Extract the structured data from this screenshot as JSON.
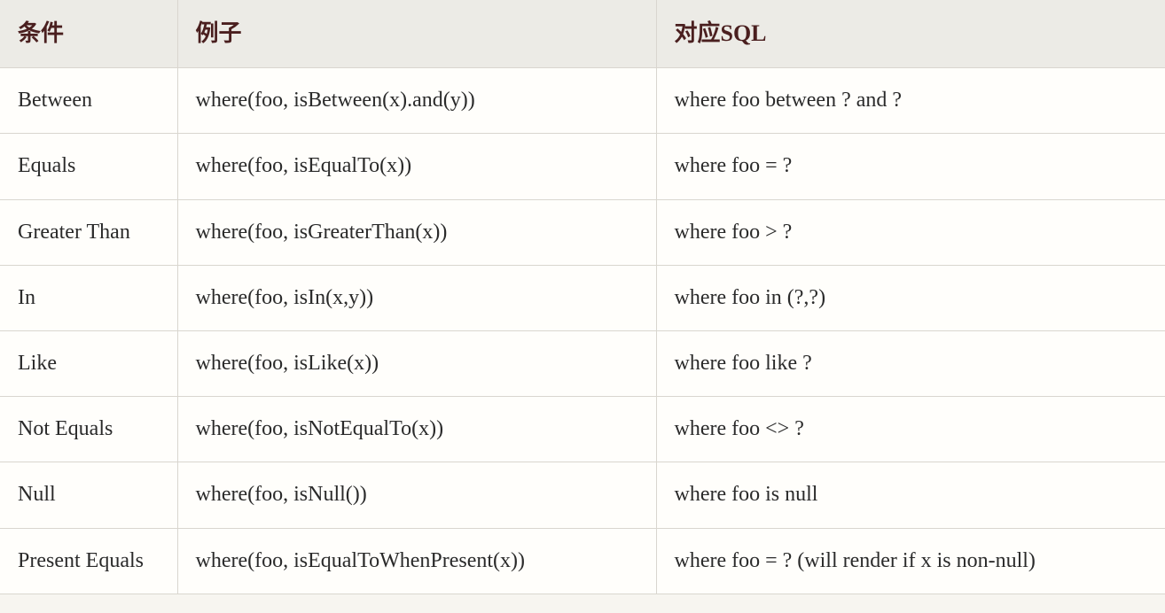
{
  "chart_data": {
    "type": "table",
    "title": "",
    "headers": [
      "条件",
      "例子",
      "对应SQL"
    ],
    "rows": [
      [
        "Between",
        "where(foo, isBetween(x).and(y))",
        "where foo between ? and ?"
      ],
      [
        "Equals",
        "where(foo, isEqualTo(x))",
        "where foo = ?"
      ],
      [
        "Greater Than",
        "where(foo, isGreaterThan(x))",
        "where foo > ?"
      ],
      [
        "In",
        "where(foo, isIn(x,y))",
        "where foo in (?,?)"
      ],
      [
        "Like",
        "where(foo, isLike(x))",
        "where foo like ?"
      ],
      [
        "Not Equals",
        "where(foo, isNotEqualTo(x))",
        "where foo <> ?"
      ],
      [
        "Null",
        "where(foo, isNull())",
        "where foo is null"
      ],
      [
        "Present Equals",
        "where(foo, isEqualToWhenPresent(x))",
        "where foo = ? (will render if x is non-null)"
      ]
    ]
  }
}
